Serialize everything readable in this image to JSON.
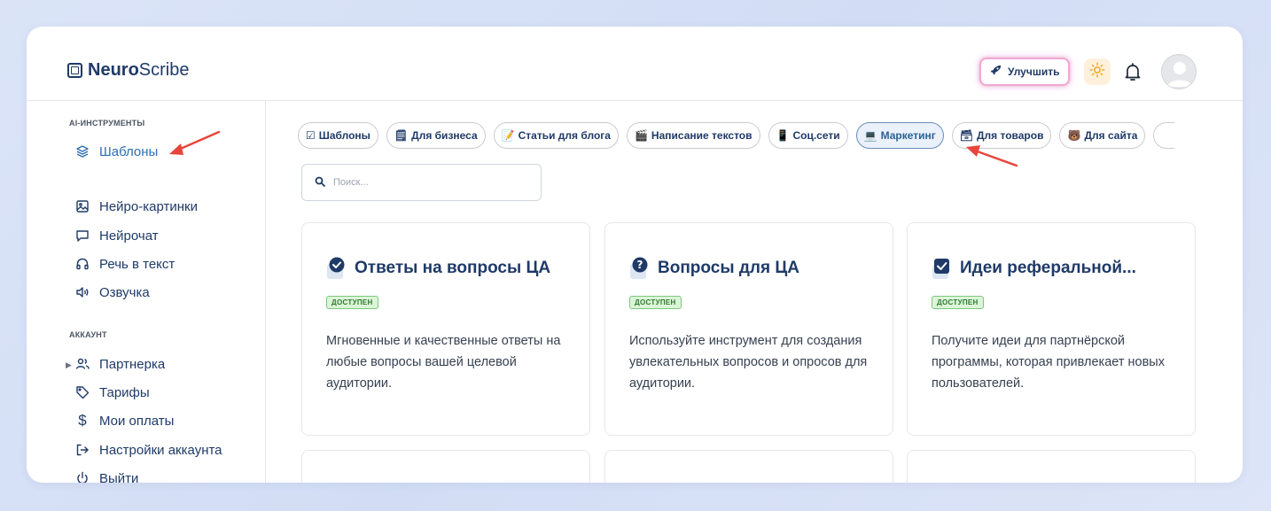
{
  "app": {
    "logo_bold": "Neuro",
    "logo_light": "Scribe"
  },
  "header": {
    "upgrade_label": "Улучшить"
  },
  "sidebar": {
    "section_tools": "AI-ИНСТРУМЕНТЫ",
    "tools": [
      {
        "label": "Шаблоны",
        "icon": "layers-icon",
        "active": true
      },
      {
        "label": "Нейро-картинки",
        "icon": "image-icon"
      },
      {
        "label": "Нейрочат",
        "icon": "chat-icon"
      },
      {
        "label": "Речь в текст",
        "icon": "headphones-icon"
      },
      {
        "label": "Озвучка",
        "icon": "speaker-icon"
      }
    ],
    "section_account": "АККАУНТ",
    "account": [
      {
        "label": "Партнерка",
        "icon": "users-icon"
      },
      {
        "label": "Тарифы",
        "icon": "tag-icon"
      },
      {
        "label": "Мои оплаты",
        "icon": "dollar-icon"
      },
      {
        "label": "Настройки аккаунта",
        "icon": "logout-arrow-icon"
      },
      {
        "label": "Выйти",
        "icon": "power-icon"
      }
    ]
  },
  "chips": [
    {
      "emoji": "☑",
      "label": "Шаблоны"
    },
    {
      "emoji": "🗒",
      "label": "Для бизнеса"
    },
    {
      "emoji": "📝",
      "label": "Статьи для блога"
    },
    {
      "emoji": "🎬",
      "label": "Написание текстов"
    },
    {
      "emoji": "📱",
      "label": "Соц.сети"
    },
    {
      "emoji": "💻",
      "label": "Маркетинг",
      "active": true
    },
    {
      "emoji": "🗃",
      "label": "Для товаров"
    },
    {
      "emoji": "🐻",
      "label": "Для сайта"
    }
  ],
  "search": {
    "placeholder": "Поиск..."
  },
  "cards": [
    {
      "title": "Ответы на вопросы ЦА",
      "badge": "ДОСТУПЕН",
      "icon": "check-circle-icon",
      "description": "Мгновенные и качественные ответы на любые вопросы вашей целевой аудитории."
    },
    {
      "title": "Вопросы для ЦА",
      "badge": "ДОСТУПЕН",
      "icon": "question-circle-icon",
      "description": "Используйте инструмент для создания увлекательных вопросов и опросов для аудитории."
    },
    {
      "title": "Идеи реферальной...",
      "badge": "ДОСТУПЕН",
      "icon": "checkbox-icon",
      "description": "Получите идеи для партнёрской программы, которая привлекает новых пользователей."
    }
  ],
  "colors": {
    "primary": "#1f3a68",
    "active": "#2f6fb0",
    "badge_bg": "#dcf5d9",
    "annotation_arrow": "#e8453c"
  }
}
